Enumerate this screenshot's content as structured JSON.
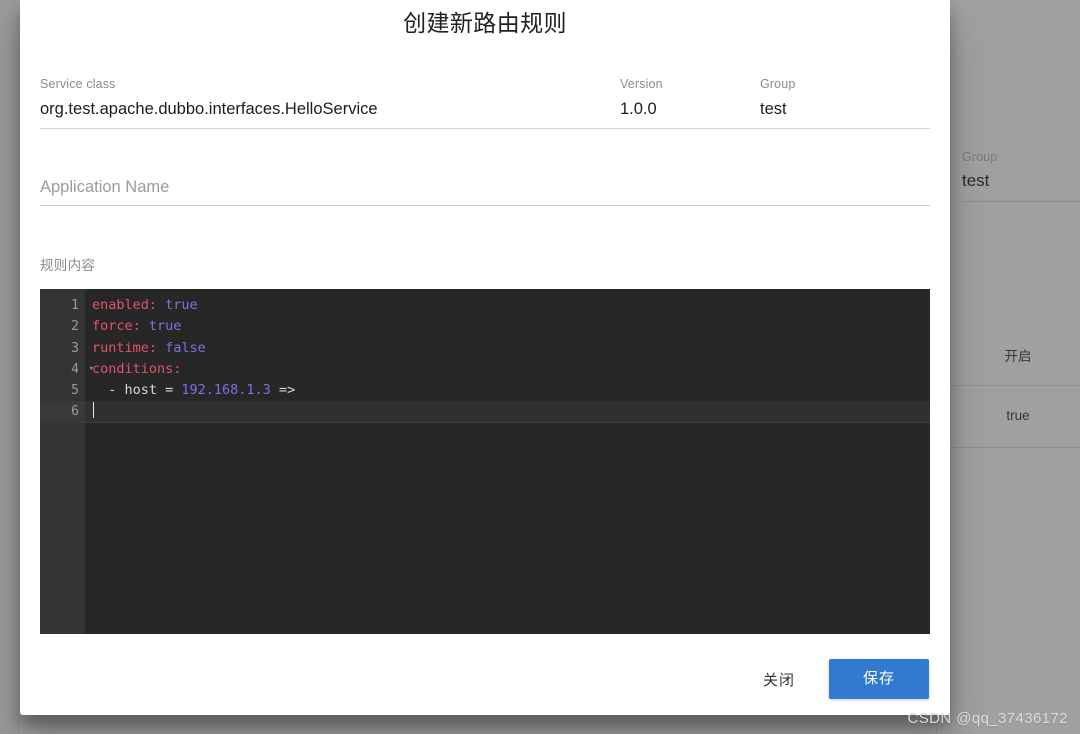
{
  "dialog": {
    "title": "创建新路由规则",
    "fields": [
      {
        "name": "service-class",
        "label": "Service class",
        "value": "org.test.apache.dubbo.interfaces.HelloService"
      },
      {
        "name": "version",
        "label": "Version",
        "value": "1.0.0"
      },
      {
        "name": "group",
        "label": "Group",
        "value": "test"
      }
    ],
    "application_name": {
      "label": "Application Name",
      "placeholder": "Application Name",
      "value": ""
    },
    "rule_content_label": "规则内容",
    "editor": {
      "language": "yaml",
      "cursor_line": 6,
      "active_line": 6,
      "lines": [
        {
          "number": "1",
          "foldable": false,
          "tokens": [
            {
              "text": "enabled:",
              "type": "key"
            },
            {
              "text": " ",
              "type": "plain"
            },
            {
              "text": "true",
              "type": "val"
            }
          ]
        },
        {
          "number": "2",
          "foldable": false,
          "tokens": [
            {
              "text": "force:",
              "type": "key"
            },
            {
              "text": " ",
              "type": "plain"
            },
            {
              "text": "true",
              "type": "val"
            }
          ]
        },
        {
          "number": "3",
          "foldable": false,
          "tokens": [
            {
              "text": "runtime:",
              "type": "key"
            },
            {
              "text": " ",
              "type": "plain"
            },
            {
              "text": "false",
              "type": "val"
            }
          ]
        },
        {
          "number": "4",
          "foldable": true,
          "fold_glyph": "▾",
          "tokens": [
            {
              "text": "conditions:",
              "type": "key"
            }
          ]
        },
        {
          "number": "5",
          "foldable": false,
          "tokens": [
            {
              "text": "  - host = ",
              "type": "plain"
            },
            {
              "text": "192.168.1.3",
              "type": "num"
            },
            {
              "text": " =>",
              "type": "plain"
            }
          ]
        },
        {
          "number": "6",
          "foldable": false,
          "tokens": []
        }
      ]
    },
    "footer": {
      "close_label": "关闭",
      "save_label": "保存"
    }
  },
  "background": {
    "group_field": {
      "label": "Group",
      "value": "test"
    },
    "rows": [
      {
        "text": "开启"
      },
      {
        "text": "true"
      }
    ]
  },
  "watermark": "CSDN @qq_37436172",
  "colors": {
    "accent": "#3279d0",
    "editor_bg": "#272727",
    "gutter_bg": "#343434",
    "yaml_key": "#e2526d",
    "yaml_value": "#7a73e0",
    "backdrop": "#9a9a9a"
  }
}
